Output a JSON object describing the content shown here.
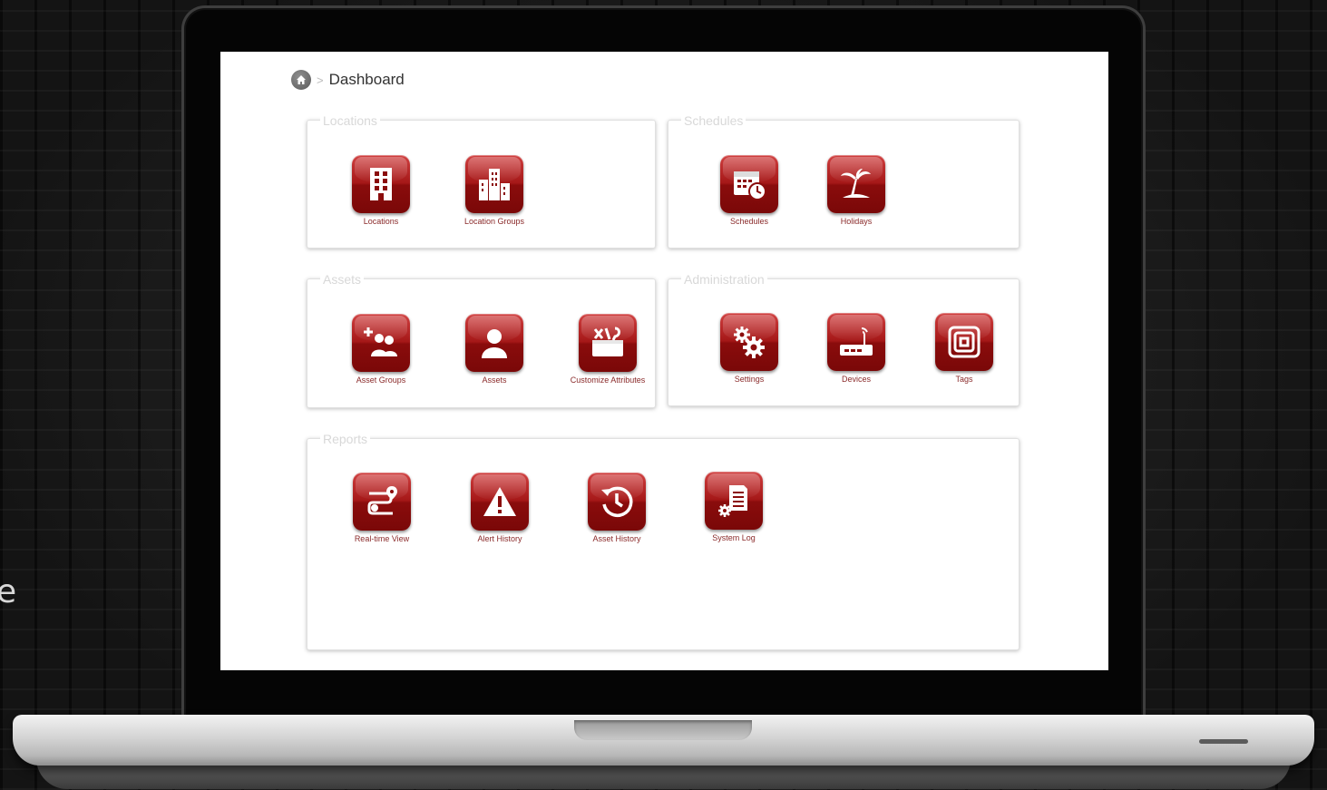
{
  "edge_text": "e",
  "breadcrumb": {
    "separator": ">",
    "title": "Dashboard"
  },
  "panels": {
    "locations": {
      "legend": "Locations",
      "tiles": [
        {
          "label": "Locations",
          "icon": "building-icon"
        },
        {
          "label": "Location Groups",
          "icon": "buildings-icon"
        }
      ]
    },
    "schedules": {
      "legend": "Schedules",
      "tiles": [
        {
          "label": "Schedules",
          "icon": "calendar-clock-icon"
        },
        {
          "label": "Holidays",
          "icon": "palm-tree-icon"
        }
      ]
    },
    "assets": {
      "legend": "Assets",
      "tiles": [
        {
          "label": "Asset Groups",
          "icon": "add-users-icon"
        },
        {
          "label": "Assets",
          "icon": "user-icon"
        },
        {
          "label": "Customize Attributes",
          "icon": "toolbox-icon"
        }
      ]
    },
    "administration": {
      "legend": "Administration",
      "tiles": [
        {
          "label": "Settings",
          "icon": "gears-icon"
        },
        {
          "label": "Devices",
          "icon": "router-icon"
        },
        {
          "label": "Tags",
          "icon": "rfid-tag-icon"
        }
      ]
    },
    "reports": {
      "legend": "Reports",
      "tiles": [
        {
          "label": "Real-time View",
          "icon": "route-pin-icon"
        },
        {
          "label": "Alert History",
          "icon": "warning-icon"
        },
        {
          "label": "Asset History",
          "icon": "history-icon"
        },
        {
          "label": "System Log",
          "icon": "log-document-icon"
        }
      ]
    }
  },
  "colors": {
    "tile_red": "#a51818",
    "label_red": "#8a2a2a",
    "legend_gray": "#d8d8d8"
  }
}
